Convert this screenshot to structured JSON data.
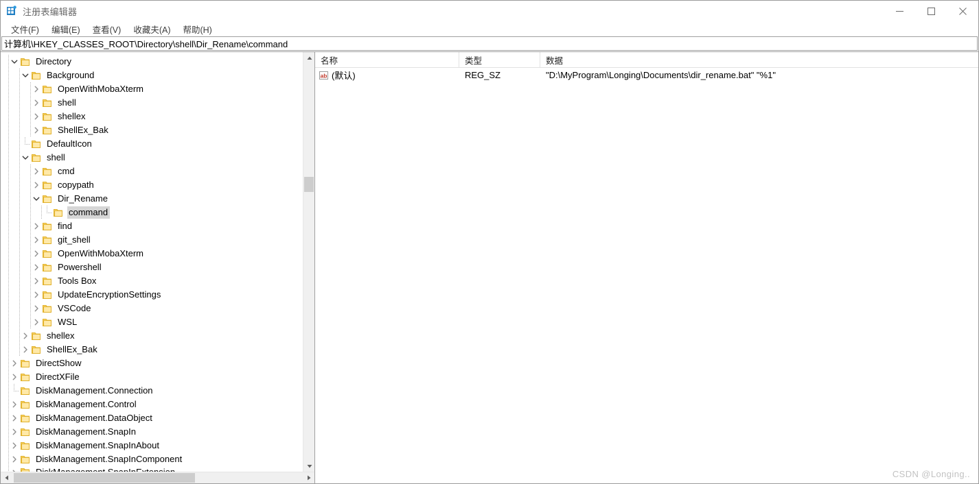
{
  "window": {
    "title": "注册表编辑器",
    "app_icon": "registry-editor-icon",
    "controls": {
      "minimize": "minimize-icon",
      "maximize": "maximize-icon",
      "close": "close-icon"
    }
  },
  "menubar": {
    "items": [
      {
        "label": "文件(F)"
      },
      {
        "label": "编辑(E)"
      },
      {
        "label": "查看(V)"
      },
      {
        "label": "收藏夫(A)"
      },
      {
        "label": "帮助(H)"
      }
    ]
  },
  "address": {
    "value": "计算机\\HKEY_CLASSES_ROOT\\Directory\\shell\\Dir_Rename\\command",
    "placeholder": ""
  },
  "tree": {
    "nodes": [
      {
        "label": "Directory",
        "depth": 1,
        "state": "expanded",
        "selected": false
      },
      {
        "label": "Background",
        "depth": 2,
        "state": "expanded",
        "selected": false
      },
      {
        "label": "OpenWithMobaXterm",
        "depth": 3,
        "state": "collapsed",
        "selected": false
      },
      {
        "label": "shell",
        "depth": 3,
        "state": "collapsed",
        "selected": false
      },
      {
        "label": "shellex",
        "depth": 3,
        "state": "collapsed",
        "selected": false
      },
      {
        "label": "ShellEx_Bak",
        "depth": 3,
        "state": "collapsed",
        "selected": false
      },
      {
        "label": "DefaultIcon",
        "depth": 2,
        "state": "leaf",
        "selected": false
      },
      {
        "label": "shell",
        "depth": 2,
        "state": "expanded",
        "selected": false
      },
      {
        "label": "cmd",
        "depth": 3,
        "state": "collapsed",
        "selected": false
      },
      {
        "label": "copypath",
        "depth": 3,
        "state": "collapsed",
        "selected": false
      },
      {
        "label": "Dir_Rename",
        "depth": 3,
        "state": "expanded",
        "selected": false
      },
      {
        "label": "command",
        "depth": 4,
        "state": "leaf",
        "selected": true
      },
      {
        "label": "find",
        "depth": 3,
        "state": "collapsed",
        "selected": false
      },
      {
        "label": "git_shell",
        "depth": 3,
        "state": "collapsed",
        "selected": false
      },
      {
        "label": "OpenWithMobaXterm",
        "depth": 3,
        "state": "collapsed",
        "selected": false
      },
      {
        "label": "Powershell",
        "depth": 3,
        "state": "collapsed",
        "selected": false
      },
      {
        "label": "Tools Box",
        "depth": 3,
        "state": "collapsed",
        "selected": false
      },
      {
        "label": "UpdateEncryptionSettings",
        "depth": 3,
        "state": "collapsed",
        "selected": false
      },
      {
        "label": "VSCode",
        "depth": 3,
        "state": "collapsed",
        "selected": false
      },
      {
        "label": "WSL",
        "depth": 3,
        "state": "collapsed",
        "selected": false
      },
      {
        "label": "shellex",
        "depth": 2,
        "state": "collapsed",
        "selected": false
      },
      {
        "label": "ShellEx_Bak",
        "depth": 2,
        "state": "collapsed",
        "selected": false
      },
      {
        "label": "DirectShow",
        "depth": 1,
        "state": "collapsed",
        "selected": false
      },
      {
        "label": "DirectXFile",
        "depth": 1,
        "state": "collapsed",
        "selected": false
      },
      {
        "label": "DiskManagement.Connection",
        "depth": 1,
        "state": "leaf",
        "selected": false
      },
      {
        "label": "DiskManagement.Control",
        "depth": 1,
        "state": "collapsed",
        "selected": false
      },
      {
        "label": "DiskManagement.DataObject",
        "depth": 1,
        "state": "collapsed",
        "selected": false
      },
      {
        "label": "DiskManagement.SnapIn",
        "depth": 1,
        "state": "collapsed",
        "selected": false
      },
      {
        "label": "DiskManagement.SnapInAbout",
        "depth": 1,
        "state": "collapsed",
        "selected": false
      },
      {
        "label": "DiskManagement.SnapInComponent",
        "depth": 1,
        "state": "collapsed",
        "selected": false
      },
      {
        "label": "DiskManagement.SnapInExtension",
        "depth": 1,
        "state": "collapsed",
        "selected": false
      }
    ]
  },
  "values": {
    "columns": [
      {
        "label": "名称"
      },
      {
        "label": "类型"
      },
      {
        "label": "数据"
      }
    ],
    "rows": [
      {
        "icon": "string-value-icon",
        "name": "(默认)",
        "type": "REG_SZ",
        "data": "\"D:\\MyProgram\\Longing\\Documents\\dir_rename.bat\" \"%1\""
      }
    ]
  },
  "watermark": {
    "text": "CSDN @Longing.."
  },
  "colors": {
    "folder": "#ffd966",
    "folder_edge": "#e8b81f",
    "selection": "#d6d6d6",
    "accent": "#0a74c8",
    "scrollbar_thumb": "#cdcdcd"
  }
}
